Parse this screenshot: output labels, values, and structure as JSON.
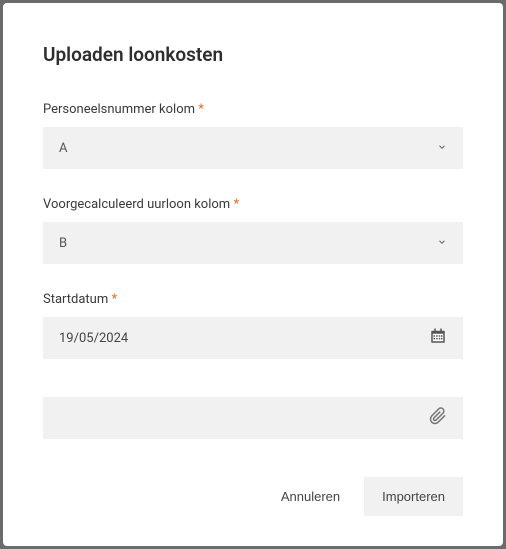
{
  "modal": {
    "title": "Uploaden loonkosten"
  },
  "fields": {
    "personnel": {
      "label": "Personeelsnummer kolom",
      "value": "A"
    },
    "precalculated": {
      "label": "Voorgecalculeerd uurloon kolom",
      "value": "B"
    },
    "startdate": {
      "label": "Startdatum",
      "value": "19/05/2024"
    }
  },
  "buttons": {
    "cancel": "Annuleren",
    "import": "Importeren"
  },
  "required_marker": "*"
}
